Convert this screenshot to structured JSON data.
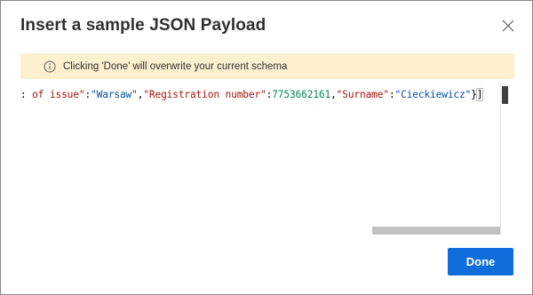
{
  "dialog": {
    "title": "Insert a sample JSON Payload",
    "close_icon": "close-icon"
  },
  "banner": {
    "icon": "info-icon",
    "message": "Clicking 'Done' will overwrite your current schema",
    "color": "#fdf0cf"
  },
  "editor": {
    "tokens": {
      "lead": ": ",
      "key1": "of issue\"",
      "colon1": ":",
      "val1": "\"Warsaw\"",
      "comma1": ",",
      "key2": "\"Registration number\"",
      "colon2": ":",
      "val2": "7753662161",
      "comma2": ",",
      "key3": "\"Surname\"",
      "colon3": ":",
      "val3": "\"Cieckiewicz\"",
      "close_brace": "}",
      "close_bracket": "]"
    }
  },
  "footer": {
    "done_label": "Done",
    "accent": "#0f6cdb"
  }
}
